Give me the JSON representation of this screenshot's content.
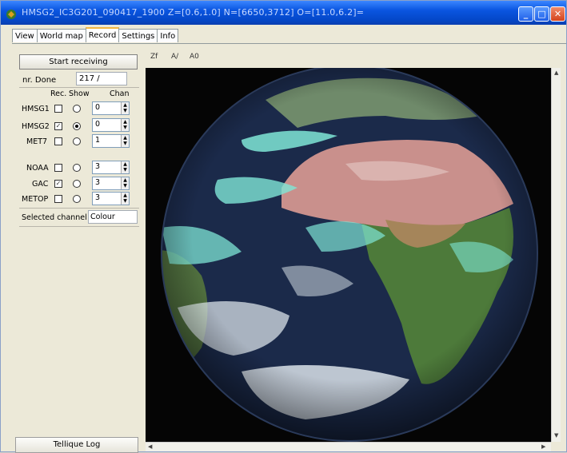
{
  "window": {
    "title": "HMSG2_IC3G201_090417_1900  Z=[0.6,1.0]  N=[6650,3712]  O=[11.0,6.2]=",
    "min_glyph": "_",
    "max_glyph": "□",
    "close_glyph": "✕"
  },
  "tabs": [
    {
      "label": "View"
    },
    {
      "label": "World map"
    },
    {
      "label": "Record",
      "active": true
    },
    {
      "label": "Settings"
    },
    {
      "label": "Info"
    }
  ],
  "record": {
    "start_label": "Start receiving",
    "done_label": "nr. Done",
    "done_value": "217  /",
    "col_rec": "Rec.",
    "col_show": "Show",
    "col_chan": "Chan",
    "satellites": [
      {
        "name": "HMSG1",
        "rec": false,
        "show": false,
        "chan": "0"
      },
      {
        "name": "HMSG2",
        "rec": true,
        "show": true,
        "chan": "0"
      },
      {
        "name": "MET7",
        "rec": false,
        "show": false,
        "chan": "1"
      },
      {
        "name": "NOAA",
        "rec": false,
        "show": false,
        "chan": "3"
      },
      {
        "name": "GAC",
        "rec": true,
        "show": false,
        "chan": "3"
      },
      {
        "name": "METOP",
        "rec": false,
        "show": false,
        "chan": "3"
      }
    ],
    "selected_label": "Selected channel",
    "selected_value": "Colour",
    "log_label": "Tellique Log"
  },
  "zoom": {
    "items": [
      "Zf",
      "A/",
      "A0"
    ]
  },
  "colors": {
    "ocean": "#1b2a4a",
    "land_desert": "#c9908c",
    "land_green": "#4d7a3a",
    "cloud": "#7fe6d6"
  }
}
